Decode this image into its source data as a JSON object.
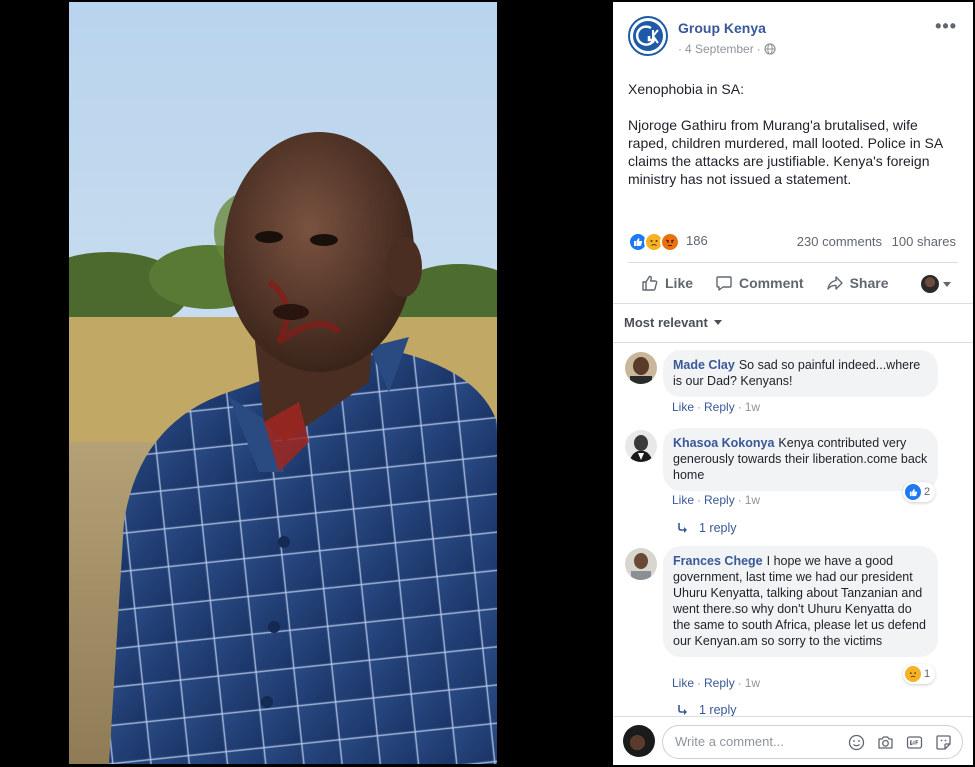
{
  "post": {
    "page_name": "Group Kenya",
    "date": "4 September",
    "privacy_icon": "globe-icon",
    "more_label": "•••",
    "text_heading": "Xenophobia in SA:",
    "text_body": "Njoroge Gathiru from Murang'a brutalised, wife raped, children murdered, mall looted. Police in SA claims the attacks are justifiable. Kenya's foreign ministry has not issued a statement.",
    "reactions": {
      "icons": [
        "like-icon",
        "sad-icon",
        "angry-icon"
      ],
      "count": "186"
    },
    "comments_count": "230 comments",
    "shares_count": "100 shares",
    "actions": {
      "like": "Like",
      "comment": "Comment",
      "share": "Share"
    }
  },
  "sort": {
    "label": "Most relevant"
  },
  "comments": [
    {
      "author": "Made Clay",
      "text": "So sad so painful indeed...where is our Dad? Kenyans!",
      "like": "Like",
      "reply": "Reply",
      "time": "1w"
    },
    {
      "author": "Khasoa Kokonya",
      "text": "Kenya contributed very generously towards their liberation.come back home",
      "like": "Like",
      "reply": "Reply",
      "time": "1w",
      "reaction_count": "2",
      "replies": "1 reply"
    },
    {
      "author": "Frances Chege",
      "text": "I hope we have a good government, last time we had our president Uhuru Kenyatta, talking about Tanzanian and went there.so why don't Uhuru Kenyatta do the same to south Africa, please let us defend our Kenyan.am so sorry to the victims",
      "like": "Like",
      "reply": "Reply",
      "time": "1w",
      "reaction_count": "1",
      "replies": "1 reply"
    }
  ],
  "composer": {
    "placeholder": "Write a comment...",
    "icons": [
      "emoji-icon",
      "camera-icon",
      "gif-icon",
      "sticker-icon"
    ]
  },
  "colors": {
    "link_blue": "#385898",
    "like_blue": "#2078f4",
    "sad_yellow": "#f7b125",
    "angry_orange": "#e9710f"
  }
}
